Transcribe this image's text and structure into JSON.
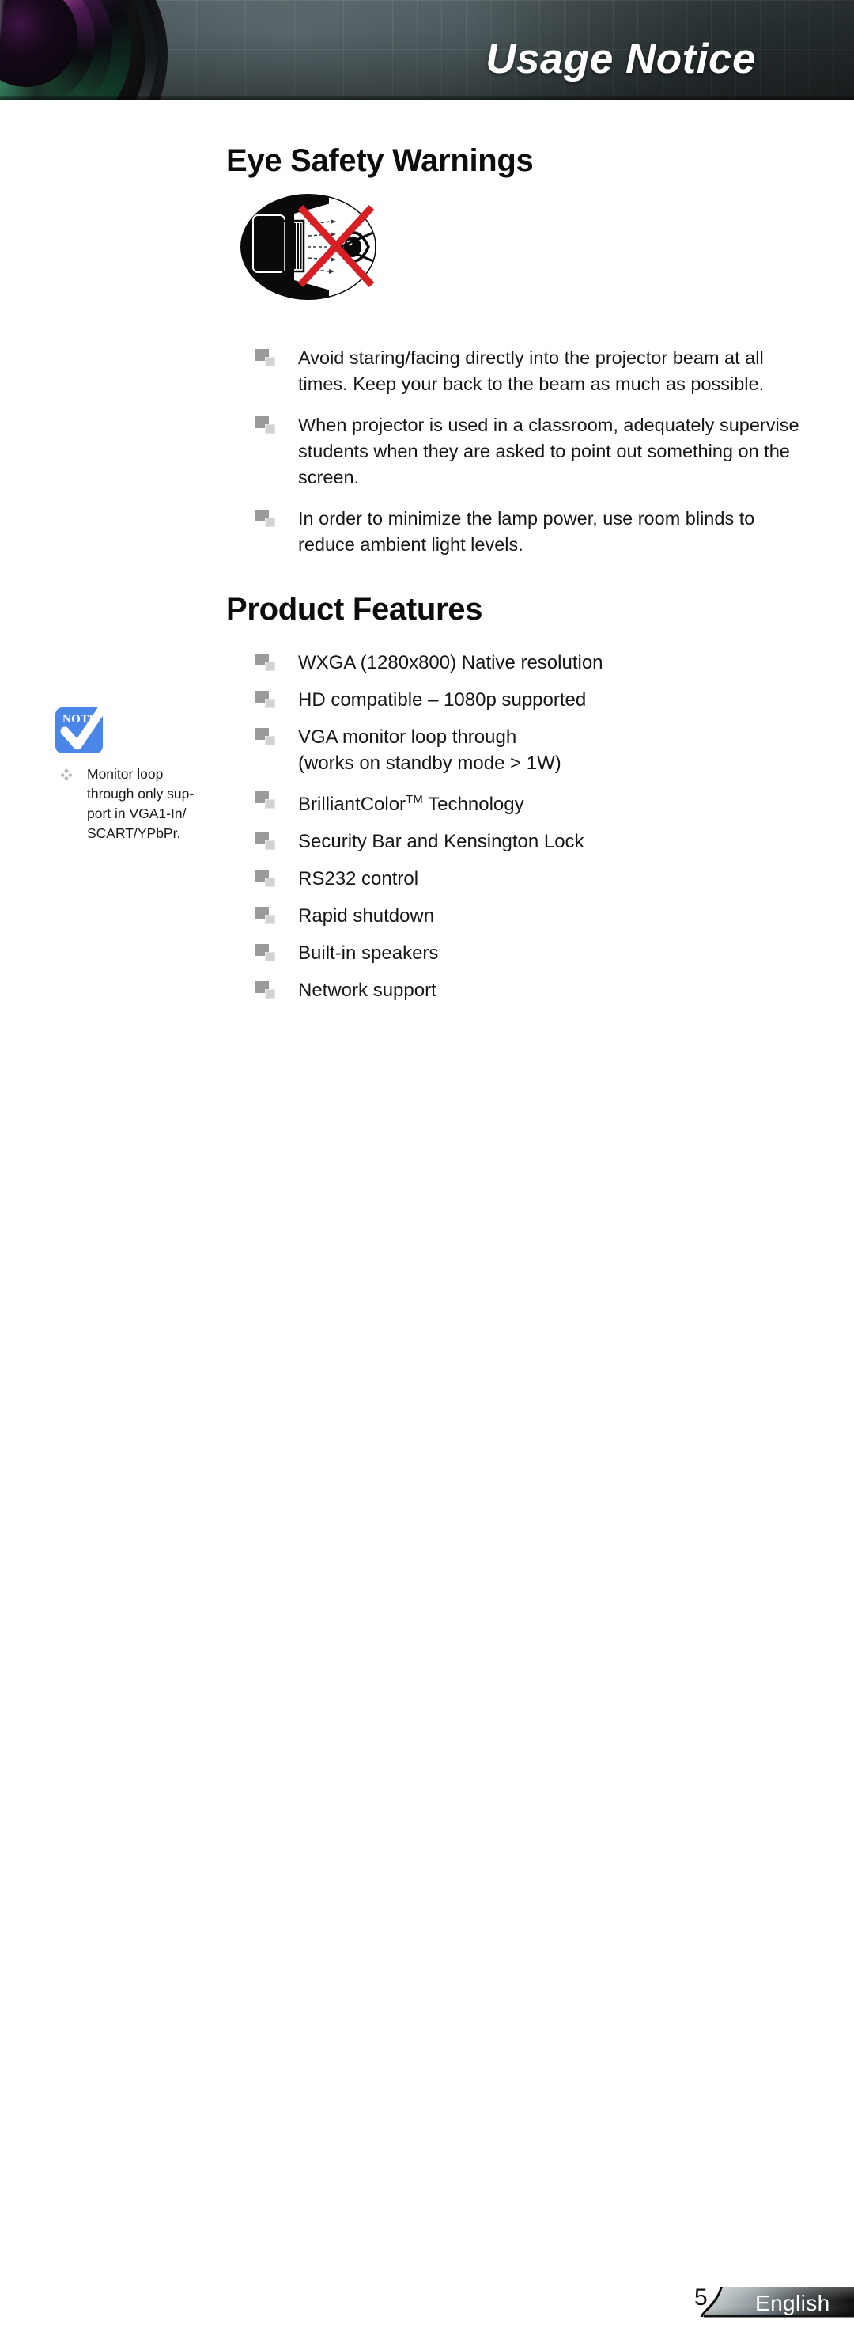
{
  "header": {
    "title": "Usage Notice",
    "lens_graphic": "camera-lens"
  },
  "sections": [
    {
      "id": "eye-safety",
      "title": "Eye Safety Warnings",
      "image_alt": "do-not-stare-into-beam-pictogram",
      "items": [
        "Avoid staring/facing directly into the projector beam at all times. Keep your back to the beam as much as possible.",
        "When projector is used in a classroom, adequately supervise students when they are asked to point out something on the screen.",
        "In order to minimize the lamp power, use room blinds to reduce ambient light levels."
      ]
    },
    {
      "id": "product-features",
      "title": "Product Features",
      "items": [
        "WXGA (1280x800) Native resolution",
        "HD compatible – 1080p supported",
        "VGA monitor loop through\n(works on standby mode > 1W)",
        "BrilliantColor™ Technology",
        "Security Bar and Kensington Lock",
        "RS232 control",
        "Rapid shutdown",
        "Built-in speakers",
        "Network support"
      ]
    }
  ],
  "note": {
    "icon_label": "NOTE",
    "bullet_glyph": "diamond-cluster",
    "text": "Monitor loop through only sup-port in VGA1-In/SCART/YPbPr."
  },
  "footer": {
    "page_number": "5",
    "language": "English"
  },
  "colors": {
    "banner_base": "#4c595c",
    "banner_dark": "#333d3f",
    "note_blue": "#4a86e8",
    "bullet_dark": "#9a9a9a",
    "bullet_light": "#d2d2d2",
    "text": "#161616",
    "warning_red": "#d81f26"
  }
}
